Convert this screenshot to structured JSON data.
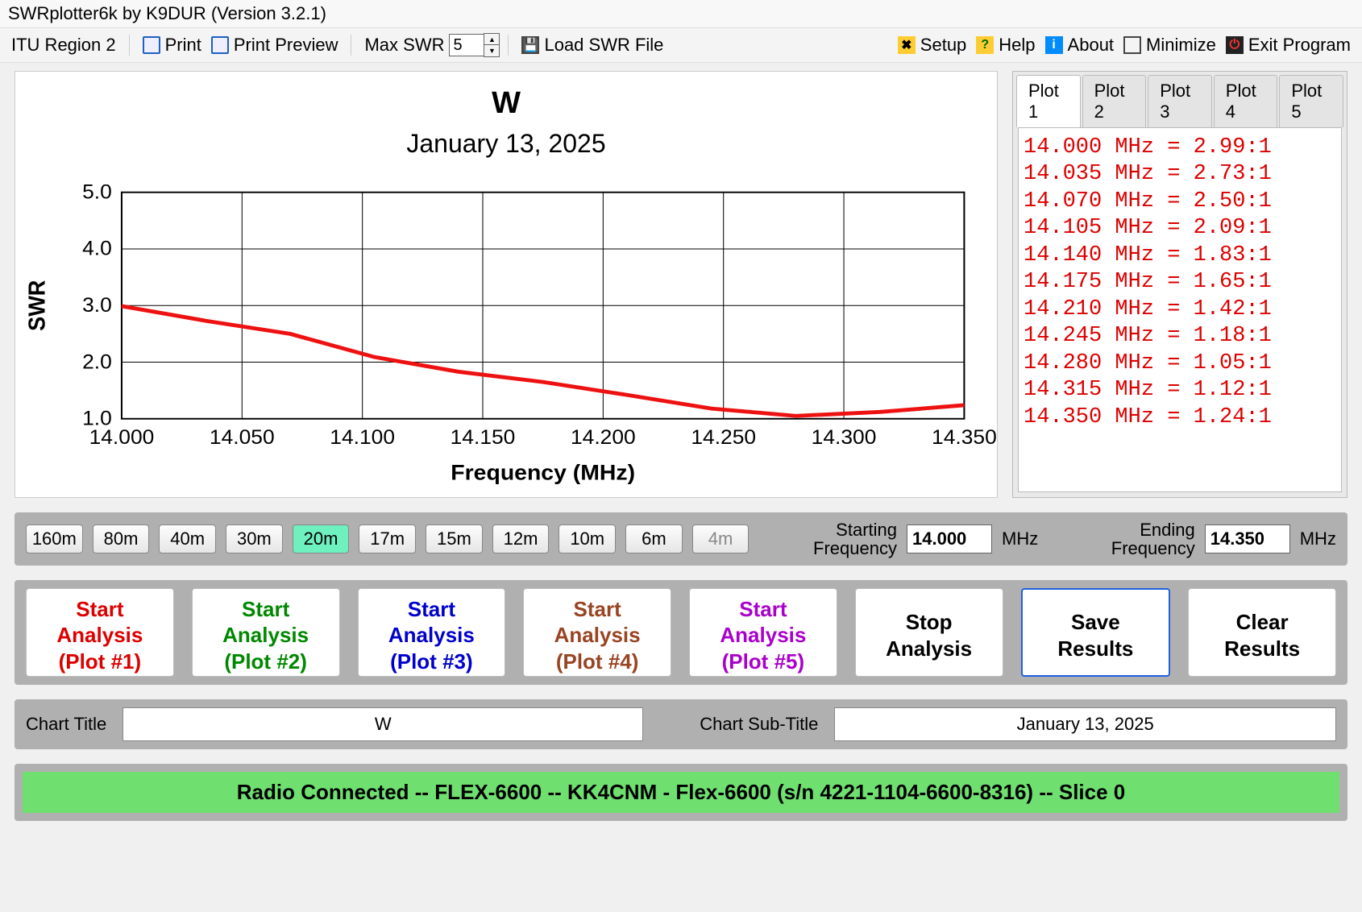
{
  "app": {
    "title": "SWRplotter6k by K9DUR (Version 3.2.1)"
  },
  "toolbar": {
    "region": "ITU Region 2",
    "print": "Print",
    "preview": "Print Preview",
    "max_swr_label": "Max SWR",
    "max_swr_value": "5",
    "load": "Load SWR File",
    "setup": "Setup",
    "help": "Help",
    "about": "About",
    "minimize": "Minimize",
    "exit": "Exit Program"
  },
  "chart_data": {
    "type": "line",
    "title": "W",
    "subtitle": "January 13, 2025",
    "xlabel": "Frequency (MHz)",
    "ylabel": "SWR",
    "xlim": [
      14.0,
      14.35
    ],
    "ylim": [
      1.0,
      5.0
    ],
    "yticks": [
      1.0,
      2.0,
      3.0,
      4.0,
      5.0
    ],
    "xticks": [
      14.0,
      14.05,
      14.1,
      14.15,
      14.2,
      14.25,
      14.3,
      14.35
    ],
    "series": [
      {
        "name": "Plot #1",
        "color": "#ee1111",
        "x": [
          14.0,
          14.035,
          14.07,
          14.105,
          14.14,
          14.175,
          14.21,
          14.245,
          14.28,
          14.315,
          14.35
        ],
        "values": [
          2.99,
          2.73,
          2.5,
          2.09,
          1.83,
          1.65,
          1.42,
          1.18,
          1.05,
          1.12,
          1.24
        ]
      }
    ]
  },
  "tabs": [
    "Plot 1",
    "Plot 2",
    "Plot 3",
    "Plot 4",
    "Plot 5"
  ],
  "active_tab": 0,
  "plot_list": [
    "14.000 MHz = 2.99:1",
    "14.035 MHz = 2.73:1",
    "14.070 MHz = 2.50:1",
    "14.105 MHz = 2.09:1",
    "14.140 MHz = 1.83:1",
    "14.175 MHz = 1.65:1",
    "14.210 MHz = 1.42:1",
    "14.245 MHz = 1.18:1",
    "14.280 MHz = 1.05:1",
    "14.315 MHz = 1.12:1",
    "14.350 MHz = 1.24:1"
  ],
  "bands": {
    "items": [
      "160m",
      "80m",
      "40m",
      "30m",
      "20m",
      "17m",
      "15m",
      "12m",
      "10m",
      "6m",
      "4m"
    ],
    "active": "20m",
    "disabled": [
      "4m"
    ],
    "start_label": "Starting\nFrequency",
    "start_val": "14.000",
    "end_label": "Ending\nFrequency",
    "end_val": "14.350",
    "unit": "MHz"
  },
  "analysis": {
    "plot1": "Start\nAnalysis\n(Plot #1)",
    "plot2": "Start\nAnalysis\n(Plot #2)",
    "plot3": "Start\nAnalysis\n(Plot #3)",
    "plot4": "Start\nAnalysis\n(Plot #4)",
    "plot5": "Start\nAnalysis\n(Plot #5)",
    "stop": "Stop\nAnalysis",
    "save": "Save\nResults",
    "clear": "Clear\nResults"
  },
  "titles": {
    "chart_title_label": "Chart Title",
    "chart_title_val": "W",
    "chart_sub_label": "Chart Sub-Title",
    "chart_sub_val": "January 13, 2025"
  },
  "status": "Radio Connected -- FLEX-6600 -- KK4CNM - Flex-6600  (s/n 4221-1104-6600-8316) -- Slice 0"
}
